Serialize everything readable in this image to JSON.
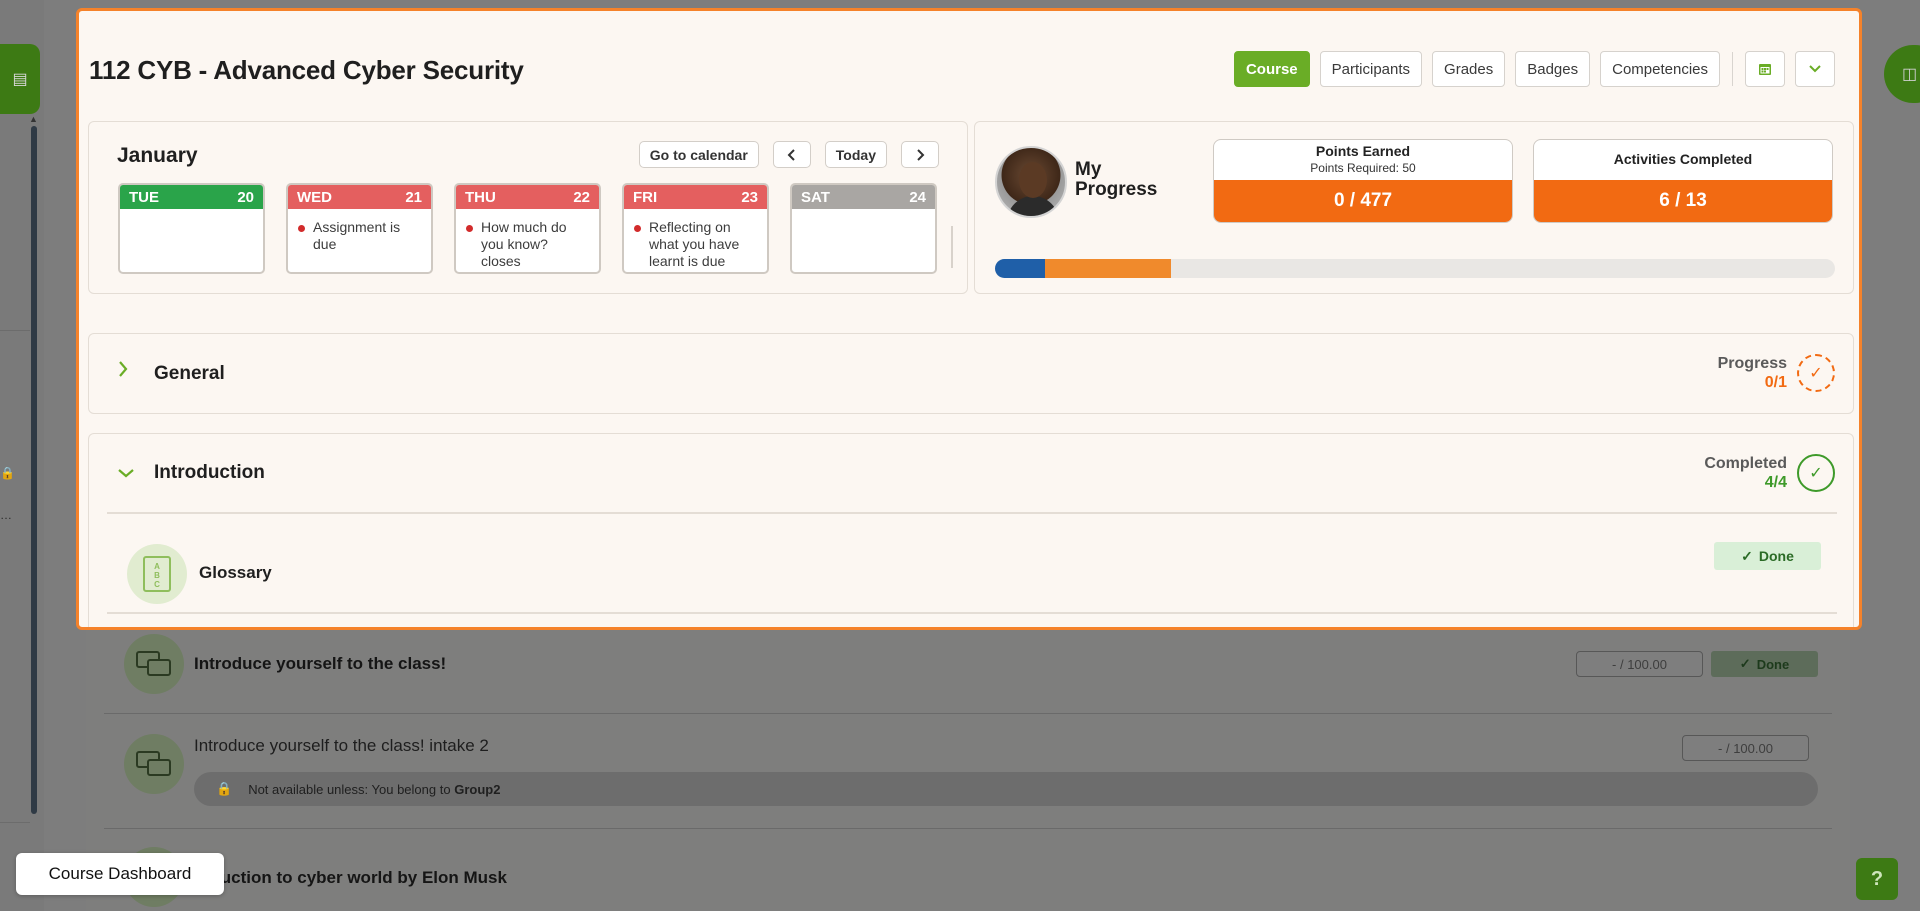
{
  "course": {
    "title": "112 CYB - Advanced Cyber Security",
    "nav": [
      "Course",
      "Participants",
      "Grades",
      "Badges",
      "Competencies"
    ],
    "active_nav": "Course"
  },
  "calendar": {
    "month": "January",
    "go_to_calendar": "Go to calendar",
    "today": "Today",
    "days": [
      {
        "name": "TUE",
        "num": "20",
        "color": "#2aa44a",
        "event": ""
      },
      {
        "name": "WED",
        "num": "21",
        "color": "#e45f5f",
        "event": "Assignment is due"
      },
      {
        "name": "THU",
        "num": "22",
        "color": "#e45f5f",
        "event": "How much do you know? closes"
      },
      {
        "name": "FRI",
        "num": "23",
        "color": "#e45f5f",
        "event": "Reflecting on what you have learnt is due"
      },
      {
        "name": "SAT",
        "num": "24",
        "color": "#a9a6a3",
        "event": ""
      }
    ]
  },
  "progress": {
    "label": "My Progress",
    "points_title": "Points Earned",
    "points_required": "Points Required: 50",
    "points_value": "0 / 477",
    "activities_title": "Activities Completed",
    "activities_value": "6 / 13",
    "bar": [
      {
        "fraction": 0.06,
        "color": "#1f5fa8"
      },
      {
        "fraction": 0.15,
        "color": "#f08a2c"
      }
    ]
  },
  "sections": {
    "general": {
      "title": "General",
      "status_label": "Progress",
      "status_value": "0/1"
    },
    "introduction": {
      "title": "Introduction",
      "status_label": "Completed",
      "status_value": "4/4"
    }
  },
  "activities": {
    "glossary": {
      "title": "Glossary",
      "done": "Done"
    },
    "intro_yourself": {
      "title": "Introduce yourself to the class!",
      "grade": "- / 100.00",
      "done": "Done"
    },
    "intro_yourself2": {
      "title": "Introduce yourself to the class! intake 2",
      "grade": "- / 100.00",
      "restriction_prefix": "Not available unless: You belong to",
      "restriction_group": "Group2"
    },
    "cyber_world": {
      "title": "oduction to cyber world by Elon Musk"
    }
  },
  "tour": {
    "chip": "Course Dashboard"
  },
  "help": {
    "label": "?"
  }
}
